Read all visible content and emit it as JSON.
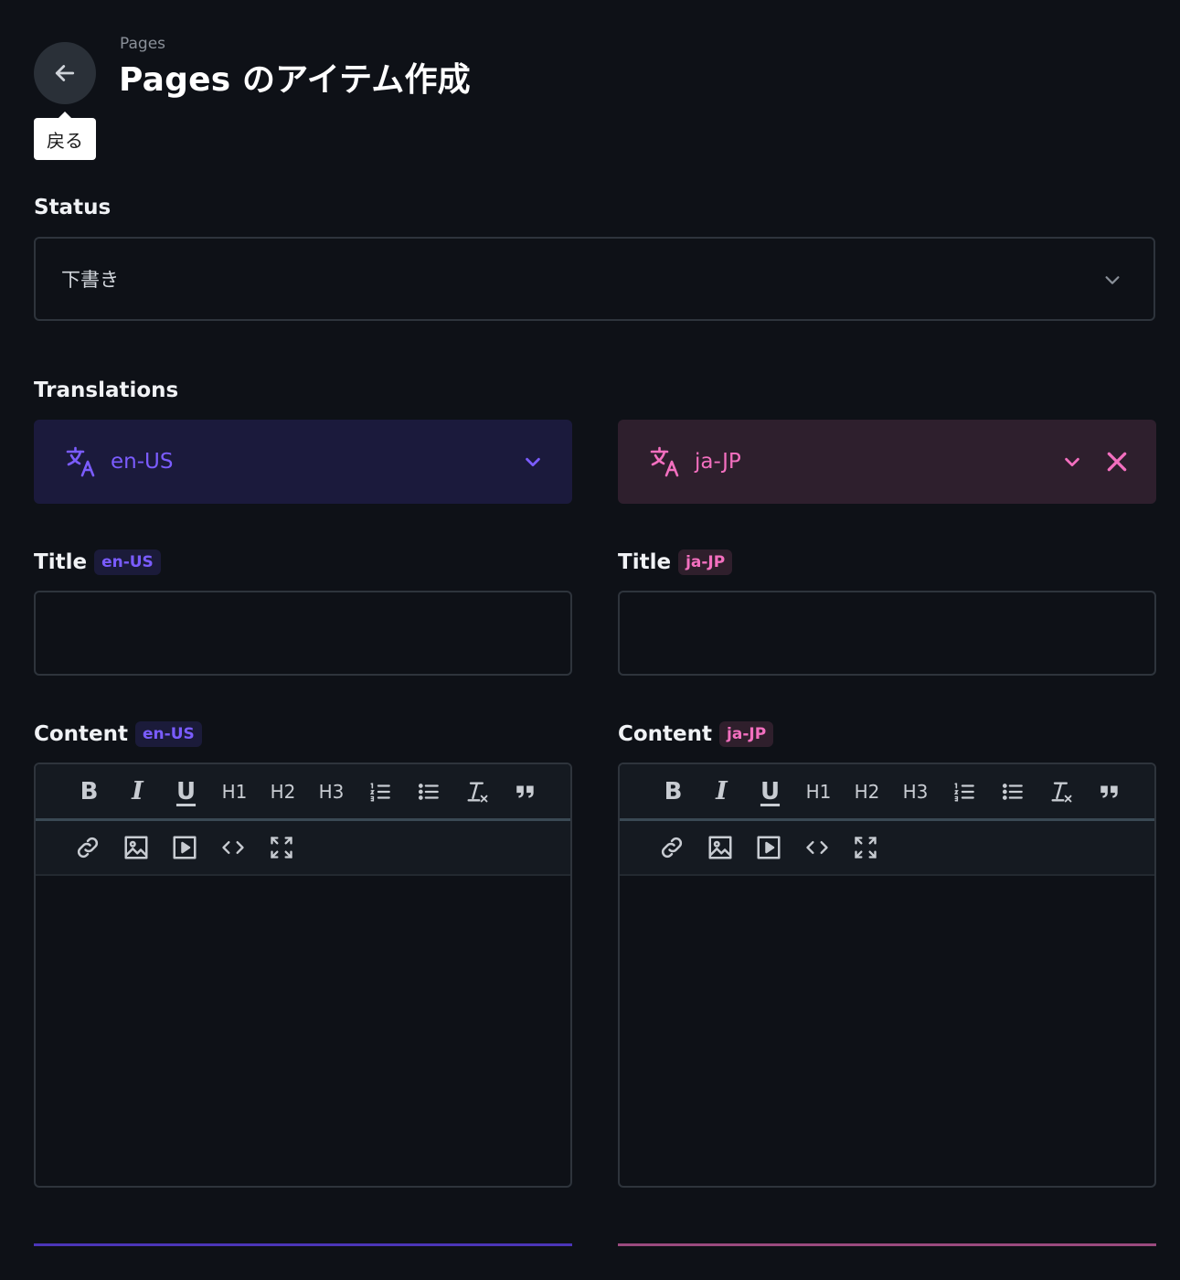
{
  "header": {
    "breadcrumb": "Pages",
    "title": "Pages のアイテム作成",
    "back_tooltip": "戻る"
  },
  "status": {
    "label": "Status",
    "value": "下書き"
  },
  "translations": {
    "label": "Translations",
    "left": {
      "lang": "en-US",
      "color": "#7b5cff",
      "bg": "#1b1a3c"
    },
    "right": {
      "lang": "ja-JP",
      "color": "#f36fbf",
      "bg": "#2e1f2d"
    }
  },
  "fields": {
    "title_label": "Title",
    "content_label": "Content"
  },
  "toolbar": {
    "bold": "B",
    "italic": "I",
    "underline": "U",
    "h1": "H1",
    "h2": "H2",
    "h3": "H3"
  }
}
